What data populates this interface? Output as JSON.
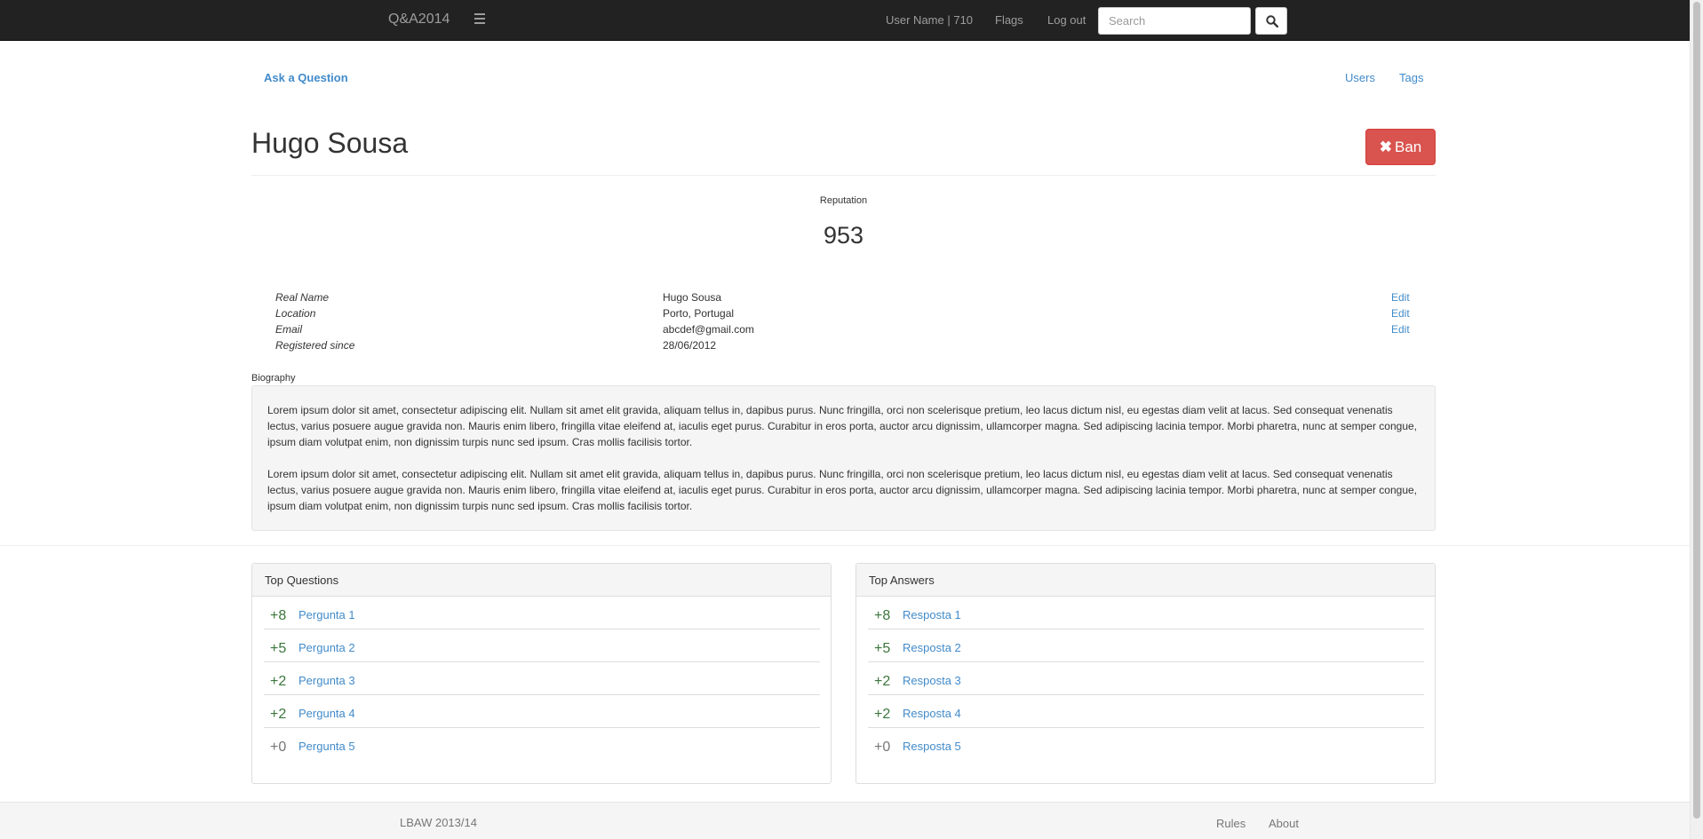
{
  "navbar": {
    "brand": "Q&A2014",
    "user": "User Name | 710",
    "flags": "Flags",
    "logout": "Log out",
    "search_placeholder": "Search"
  },
  "subnav": {
    "ask": "Ask a Question",
    "users": "Users",
    "tags": "Tags"
  },
  "profile": {
    "name": "Hugo Sousa",
    "ban_label": "Ban",
    "reputation_label": "Reputation",
    "reputation": "953",
    "fields": [
      {
        "label": "Real Name",
        "value": "Hugo Sousa",
        "edit": "Edit"
      },
      {
        "label": "Location",
        "value": "Porto, Portugal",
        "edit": "Edit"
      },
      {
        "label": "Email",
        "value": "abcdef@gmail.com",
        "edit": "Edit"
      },
      {
        "label": "Registered since",
        "value": "28/06/2012"
      }
    ],
    "biography_label": "Biography",
    "biography": [
      "Lorem ipsum dolor sit amet, consectetur adipiscing elit. Nullam sit amet elit gravida, aliquam tellus in, dapibus purus. Nunc fringilla, orci non scelerisque pretium, leo lacus dictum nisl, eu egestas diam velit at lacus. Sed consequat venenatis lectus, varius posuere augue gravida non. Mauris enim libero, fringilla vitae eleifend at, iaculis eget purus. Curabitur in eros porta, auctor arcu dignissim, ullamcorper magna. Sed adipiscing lacinia tempor. Morbi pharetra, nunc at semper congue, ipsum diam volutpat enim, non dignissim turpis nunc sed ipsum. Cras mollis facilisis tortor.",
      "Lorem ipsum dolor sit amet, consectetur adipiscing elit. Nullam sit amet elit gravida, aliquam tellus in, dapibus purus. Nunc fringilla, orci non scelerisque pretium, leo lacus dictum nisl, eu egestas diam velit at lacus. Sed consequat venenatis lectus, varius posuere augue gravida non. Mauris enim libero, fringilla vitae eleifend at, iaculis eget purus. Curabitur in eros porta, auctor arcu dignissim, ullamcorper magna. Sed adipiscing lacinia tempor. Morbi pharetra, nunc at semper congue, ipsum diam volutpat enim, non dignissim turpis nunc sed ipsum. Cras mollis facilisis tortor."
    ]
  },
  "top_questions": {
    "title": "Top Questions",
    "items": [
      {
        "score": "+8",
        "label": "Pergunta 1"
      },
      {
        "score": "+5",
        "label": "Pergunta 2"
      },
      {
        "score": "+2",
        "label": "Pergunta 3"
      },
      {
        "score": "+2",
        "label": "Pergunta 4"
      },
      {
        "score": "+0",
        "label": "Pergunta 5"
      }
    ]
  },
  "top_answers": {
    "title": "Top Answers",
    "items": [
      {
        "score": "+8",
        "label": "Resposta 1"
      },
      {
        "score": "+5",
        "label": "Resposta 2"
      },
      {
        "score": "+2",
        "label": "Resposta 3"
      },
      {
        "score": "+2",
        "label": "Resposta 4"
      },
      {
        "score": "+0",
        "label": "Resposta 5"
      }
    ]
  },
  "footer": {
    "text": "LBAW 2013/14",
    "rules": "Rules",
    "about": "About"
  },
  "colors": {
    "navbar": "#222222",
    "link": "#428bca",
    "danger": "#d9534f",
    "positive": "#3c763d"
  }
}
